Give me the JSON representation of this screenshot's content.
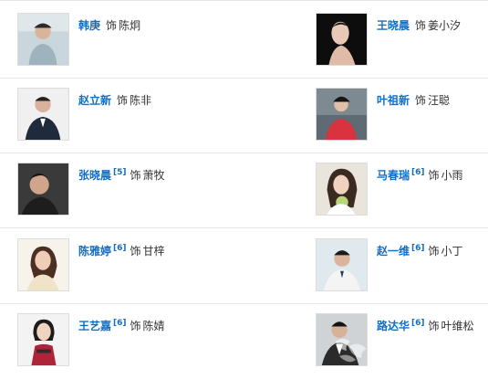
{
  "cast": [
    {
      "actor": "韩庚",
      "ref": "",
      "as": "饰",
      "role": "陈炯",
      "photo_icon": "actor-photo"
    },
    {
      "actor": "王晓晨",
      "ref": "",
      "as": "饰",
      "role": "姜小汐",
      "photo_icon": "actor-photo"
    },
    {
      "actor": "赵立新",
      "ref": "",
      "as": "饰",
      "role": "陈非",
      "photo_icon": "actor-photo"
    },
    {
      "actor": "叶祖新",
      "ref": "",
      "as": "饰",
      "role": "汪聪",
      "photo_icon": "actor-photo"
    },
    {
      "actor": "张晓晨",
      "ref": "[5]",
      "as": "饰",
      "role": "萧牧",
      "photo_icon": "actor-photo"
    },
    {
      "actor": "马春瑞",
      "ref": "[6]",
      "as": "饰",
      "role": "小雨",
      "photo_icon": "actor-photo"
    },
    {
      "actor": "陈雅婷",
      "ref": "[6]",
      "as": "饰",
      "role": "甘梓",
      "photo_icon": "actor-photo"
    },
    {
      "actor": "赵一维",
      "ref": "[6]",
      "as": "饰",
      "role": "小丁",
      "photo_icon": "actor-photo"
    },
    {
      "actor": "王艺嘉",
      "ref": "[6]",
      "as": "饰",
      "role": "陈婧",
      "photo_icon": "actor-photo"
    },
    {
      "actor": "路达华",
      "ref": "[6]",
      "as": "饰",
      "role": "叶维松",
      "photo_icon": "actor-photo"
    }
  ],
  "colors": {
    "link": "#136ec2",
    "text": "#333333",
    "divider": "#e8e8e8"
  }
}
